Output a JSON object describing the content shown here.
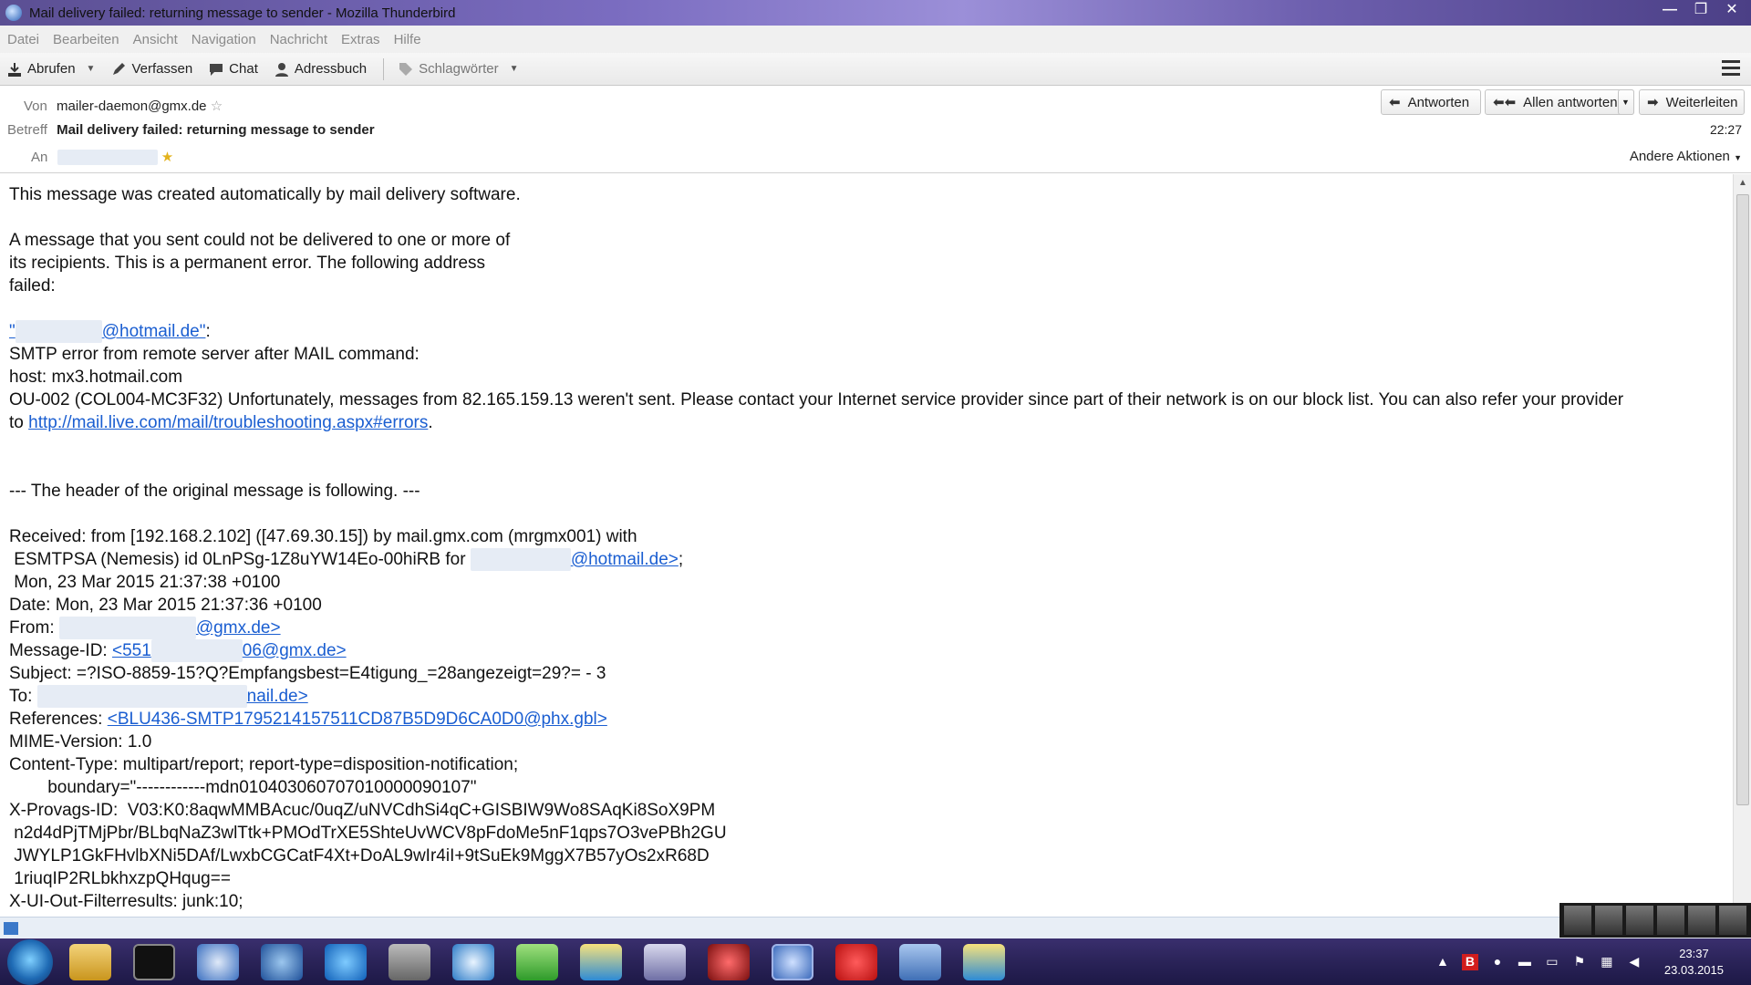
{
  "window": {
    "title": "Mail delivery failed: returning message to sender - Mozilla Thunderbird",
    "minimize": "—",
    "maximize": "❐",
    "close": "✕"
  },
  "menubar": [
    "Datei",
    "Bearbeiten",
    "Ansicht",
    "Navigation",
    "Nachricht",
    "Extras",
    "Hilfe"
  ],
  "toolbar": {
    "get_mail": "Abrufen",
    "compose": "Verfassen",
    "chat": "Chat",
    "address_book": "Adressbuch",
    "tags": "Schlagwörter"
  },
  "header": {
    "from_label": "Von",
    "from_value": "mailer-daemon@gmx.de",
    "subject_label": "Betreff",
    "subject_value": "Mail delivery failed: returning message to sender",
    "to_label": "An",
    "time": "22:27",
    "other_actions": "Andere Aktionen",
    "reply": "Antworten",
    "reply_all": "Allen antworten",
    "forward": "Weiterleiten"
  },
  "body": {
    "line1": "This message was created automatically by mail delivery software.",
    "para2": "A message that you sent could not be delivered to one or more of\nits recipients. This is a permanent error. The following address\nfailed:",
    "failed_addr": "@hotmail.de\"",
    "failed_addr_suffix": ":",
    "smtp": "SMTP error from remote server after MAIL command:",
    "host": "host: mx3.hotmail.com",
    "ou": "OU-002 (COL004-MC3F32) Unfortunately, messages from 82.165.159.13 weren't sent. Please contact your Internet service provider since part of their network is on our block list. You can also refer your provider",
    "to_prefix": "to ",
    "trouble_link": "http://mail.live.com/mail/troubleshooting.aspx#errors",
    "period": ".",
    "header_notice": "--- The header of the original message is following. ---",
    "received1": "Received: from [192.168.2.102] ([47.69.30.15]) by mail.gmx.com (mrgmx001) with",
    "received2": " ESMTPSA (Nemesis) id 0LnPSg-1Z8uYW14Eo-00hiRB for ",
    "received2_link": "@hotmail.de>",
    "received2_end": ";",
    "received3": " Mon, 23 Mar 2015 21:37:38 +0100",
    "date": "Date: Mon, 23 Mar 2015 21:37:36 +0100",
    "from_prefix": "From: ",
    "from_link": "@gmx.de>",
    "msgid_prefix": "Message-ID: ",
    "msgid_link1": "<551",
    "msgid_link2": "06@gmx.de>",
    "subject": "Subject: =?ISO-8859-15?Q?Empfangsbest=E4tigung_=28angezeigt=29?= - 3",
    "to_line_prefix": "To: ",
    "to_line_link": "nail.de>",
    "references_prefix": "References: ",
    "references_link": "<BLU436-SMTP1795214157511CD87B5D9D6CA0D0@phx.gbl>",
    "mime": "MIME-Version: 1.0",
    "content_type": "Content-Type: multipart/report; report-type=disposition-notification;",
    "boundary": "        boundary=\"------------mdn010403060707010000090107\"",
    "provags1": "X-Provags-ID:  V03:K0:8aqwMMBAcuc/0uqZ/uNVCdhSi4qC+GISBIW9Wo8SAqKi8SoX9PM",
    "provags2": " n2d4dPjTMjPbr/BLbqNaZ3wlTtk+PMOdTrXE5ShteUvWCV8pFdoMe5nF1qps7O3vePBh2GU",
    "provags3": " JWYLP1GkFHvlbXNi5DAf/LwxbCGCatF4Xt+DoAL9wIr4iI+9tSuEk9MggX7B57yOs2xR68D",
    "provags4": " 1riuqIP2RLbkhxzpQHqug==",
    "filter": "X-UI-Out-Filterresults: junk:10;"
  },
  "taskbar": {
    "time": "23:37",
    "date": "23.03.2015"
  },
  "colors": {
    "link": "#1a5ed1",
    "taskbar": "#2a2358"
  }
}
